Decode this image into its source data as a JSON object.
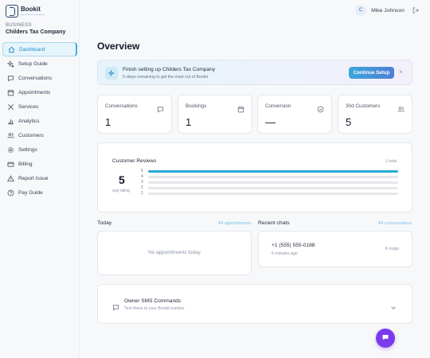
{
  "app": {
    "name": "Bookit"
  },
  "business": {
    "label": "BUSINESS",
    "name": "Childers Tax Company"
  },
  "sidebar": {
    "items": [
      {
        "label": "Dashboard",
        "icon": "home-icon",
        "active": true
      },
      {
        "label": "Setup Guide",
        "icon": "sparkles-icon"
      },
      {
        "label": "Conversations",
        "icon": "chat-icon"
      },
      {
        "label": "Appointments",
        "icon": "calendar-icon"
      },
      {
        "label": "Services",
        "icon": "tools-icon"
      },
      {
        "label": "Analytics",
        "icon": "bar-chart-icon"
      },
      {
        "label": "Customers",
        "icon": "users-icon"
      },
      {
        "label": "Settings",
        "icon": "gear-icon"
      },
      {
        "label": "Billing",
        "icon": "card-icon"
      },
      {
        "label": "Report Issue",
        "icon": "warning-icon"
      },
      {
        "label": "Pay Guide",
        "icon": "help-icon"
      }
    ]
  },
  "user": {
    "initial": "C",
    "name": "Mike Johnson"
  },
  "page": {
    "title": "Overview"
  },
  "setup_banner": {
    "title": "Finish setting up Childers Tax Company",
    "subtitle": "5 steps remaining to get the most out of Bookit",
    "button": "Continue Setup",
    "close": "×"
  },
  "stats": [
    {
      "label": "Conversations",
      "value": "1",
      "icon": "chat-icon"
    },
    {
      "label": "Bookings",
      "value": "1",
      "icon": "calendar-icon"
    },
    {
      "label": "Conversion",
      "value": "—",
      "icon": "shield-icon"
    },
    {
      "label": "30d Customers",
      "value": "5",
      "icon": "users-icon"
    }
  ],
  "reviews": {
    "title": "Customer Reviews",
    "total": "1 total",
    "average": "5",
    "average_label": "avg rating",
    "distribution": [
      {
        "stars": "5",
        "fraction": 1.0
      },
      {
        "stars": "4",
        "fraction": 0
      },
      {
        "stars": "3",
        "fraction": 0
      },
      {
        "stars": "2",
        "fraction": 0
      },
      {
        "stars": "1",
        "fraction": 0
      }
    ]
  },
  "today": {
    "title": "Today",
    "link": "All appointments",
    "empty": "No appointments today"
  },
  "recent_chats": {
    "title": "Recent chats",
    "link": "All conversations",
    "items": [
      {
        "phone": "+1 (555) 555-0188",
        "time": "6 minutes ago",
        "count": "6 msgs"
      }
    ]
  },
  "sms": {
    "title": "Owner SMS Commands",
    "subtitle": "Text these to your Bookit number"
  },
  "colors": {
    "accent": "#27a9d6",
    "fab": "#7c3aed",
    "brand": "#2b4a6e"
  }
}
